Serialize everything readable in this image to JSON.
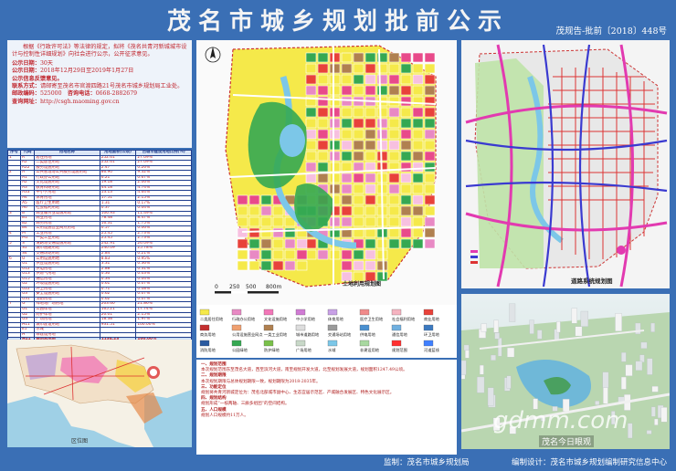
{
  "header": {
    "title": "茂名市城乡规划批前公示",
    "doc_no": "茂规告-批前〔2018〕448号"
  },
  "notice": {
    "body": "根据《行政许可法》等法律的规定，拟将《茂名共青河新城城市设计与控制性详细规划》向社会进行公示，公开征求意见。",
    "period_label": "公示日期：",
    "period_value": "30天",
    "dates_label": "公示日期：",
    "dates_value": "2018年12月29日至2019年1月27日",
    "feedback_label": "公示信息反馈意见。",
    "contact_label": "联系方式：",
    "contact_value": "请邮寄至茂名市官渡四路21号茂名市城乡规划局工业处。",
    "postcode_label": "邮政编码：",
    "postcode_value": "525000",
    "phone_label": "咨询电话：",
    "phone_value": "0668-2882679",
    "website_label": "查询网址：",
    "website_value": "http://csgh.maoming.gov.cn"
  },
  "table": {
    "headers": [
      "序号",
      "代码",
      "用地名称",
      "用地面积(公顷)",
      "占城市建设用地比例(%)"
    ],
    "rows": [
      [
        "1",
        "R",
        "居住用地",
        "252.61",
        "27.09%"
      ],
      [
        "",
        "R2",
        "二类居住用地",
        "252.61",
        "27.09%"
      ],
      [
        "",
        "R22",
        "服务设施用地",
        "2.47",
        "0.26%"
      ],
      [
        "2",
        "A",
        "公共管理与公共服务设施用地",
        "86.90",
        "9.32%"
      ],
      [
        "",
        "A1",
        "行政办公用地",
        "6.21",
        "0.67%"
      ],
      [
        "",
        "A2",
        "文化设施用地",
        "19.18",
        "2.06%"
      ],
      [
        "",
        "A3",
        "教育科研用地",
        "44.18",
        "4.74%"
      ],
      [
        "",
        "A33",
        "中小学用地",
        "53.13",
        "4.64%"
      ],
      [
        "",
        "A4",
        "体育用地",
        "17.51",
        "2.15%"
      ],
      [
        "",
        "A5",
        "医疗卫生用地",
        "1.31",
        "0.17%"
      ],
      [
        "",
        "A6",
        "社会福利用地",
        "0.37",
        "0.04%"
      ],
      [
        "3",
        "B",
        "商业服务业设施用地",
        "106.93",
        "11.49%"
      ],
      [
        "",
        "B1",
        "商业用地",
        "78.48",
        "8.47%"
      ],
      [
        "",
        "B2",
        "商务用地",
        "16.31",
        "1.75%"
      ],
      [
        "",
        "B4",
        "公用设施营业网点用地",
        "0.57",
        "0.06%"
      ],
      [
        "4",
        "M",
        "工业用地",
        "25.45",
        "2.73%"
      ],
      [
        "",
        "M1",
        "一类工业用地",
        "25.45",
        "2.73%"
      ],
      [
        "5",
        "S",
        "道路与交通设施用地",
        "242.91",
        "26.09%"
      ],
      [
        "",
        "S1",
        "城市道路用地",
        "240.09",
        "25.78%"
      ],
      [
        "",
        "S4",
        "交通场站用地",
        "2.84",
        "0.21%"
      ],
      [
        "6",
        "U",
        "公用设施用地",
        "8.83",
        "0.95%"
      ],
      [
        "",
        "U1",
        "供应设施用地",
        "3.31",
        "0.36%"
      ],
      [
        "",
        "U12",
        "供电用地",
        "2.88",
        "0.31%"
      ],
      [
        "",
        "U13",
        "供燃气用地",
        "0.30",
        "0.03%"
      ],
      [
        "",
        "U15",
        "通信用地",
        "0.34",
        "0.04%"
      ],
      [
        "",
        "U2",
        "环境设施用地",
        "0.61",
        "0.07%"
      ],
      [
        "",
        "U22",
        "环卫用地",
        "0.71",
        "0.08%"
      ],
      [
        "",
        "U3",
        "安全设施用地",
        "0.62",
        "0.07%"
      ],
      [
        "",
        "U31",
        "消防用地",
        "0.62",
        "0.07%"
      ],
      [
        "7",
        "G",
        "绿地与广场用地",
        "203.60",
        "21.86%"
      ],
      [
        "",
        "G1",
        "公园绿地",
        "165.21",
        "17.74%"
      ],
      [
        "",
        "G2",
        "防护绿地",
        "20.01",
        "2.15%"
      ],
      [
        "",
        "G3",
        "广场用地",
        "18.38",
        "1.97%"
      ],
      [
        "",
        "H11",
        "城市建设用地",
        "931.51",
        "100.00%"
      ],
      [
        "",
        "E1",
        "水域",
        "",
        ""
      ],
      [
        "",
        "H",
        "非建设用地",
        "",
        ""
      ]
    ],
    "total": [
      "",
      "H11",
      "规划总用地",
      "1134.23",
      "100.00%"
    ]
  },
  "region_caption": "区位图",
  "landuse_caption": "土地利用规划图",
  "scale_labels": [
    "0",
    "250",
    "500",
    "800m"
  ],
  "road_caption": "道路系统规划图",
  "text": {
    "s1_title": "一、规划范围",
    "s1_body": "本次规划范围东至茂名大道，西至滨河大道，南至规划开发大道，北至规划发展大道，规划面积1247.49公顷。",
    "s2_title": "二、规划期限",
    "s2_body": "本次规划期限与总体规划期限一致，规划期限为2018-2035年。",
    "s3_title": "三、功能定位",
    "s3_body": "规划将共青河新城定位为：茂名北部城市副中心、生态宜居示范区、产城融合发展区、特色文化展示区。",
    "s4_title": "四、规划结构",
    "s4_body": "规划形成“一核两轴、三廊多组团”的空间结构。",
    "s5_title": "五、人口规模",
    "s5_body": "规划人口规模约11万人。"
  },
  "footer": {
    "supervise": "监制：茂名市城乡规划局",
    "design": "编制设计：茂名市城乡规划编制研究信息中心"
  },
  "watermark": {
    "site": "gdmm.com",
    "wechat": "茂名今日眼观"
  },
  "colors": {
    "residential": "#f5e94a",
    "commercial": "#e8423a",
    "green": "#35a852",
    "water": "#7cc7e8",
    "public": "#e889c4",
    "industry": "#b08050",
    "road": "#ffffff"
  },
  "legend": [
    {
      "name": "二类居住用地",
      "color": "#f5e94a"
    },
    {
      "name": "行政办公用地",
      "color": "#e889c4"
    },
    {
      "name": "文化设施用地",
      "color": "#f277b8"
    },
    {
      "name": "中小学用地",
      "color": "#d07bd4"
    },
    {
      "name": "体育用地",
      "color": "#c8a0e6"
    },
    {
      "name": "医疗卫生用地",
      "color": "#f08a8a"
    },
    {
      "name": "社会福利用地",
      "color": "#f5b3c0"
    },
    {
      "name": "商业用地",
      "color": "#e8423a"
    },
    {
      "name": "商务用地",
      "color": "#c42e2e"
    },
    {
      "name": "公用设施营业网点",
      "color": "#f0a070"
    },
    {
      "name": "一类工业用地",
      "color": "#b08050"
    },
    {
      "name": "城市道路用地",
      "color": "#dddddd"
    },
    {
      "name": "交通场站用地",
      "color": "#9a9a9a"
    },
    {
      "name": "供电用地",
      "color": "#4a90d0"
    },
    {
      "name": "通信用地",
      "color": "#70b0e0"
    },
    {
      "name": "环卫用地",
      "color": "#3c7ac0"
    },
    {
      "name": "消防用地",
      "color": "#2a5aa0"
    },
    {
      "name": "公园绿地",
      "color": "#35a852"
    },
    {
      "name": "防护绿地",
      "color": "#7ac04a"
    },
    {
      "name": "广场用地",
      "color": "#c8d8c8"
    },
    {
      "name": "水域",
      "color": "#7cc7e8"
    },
    {
      "name": "非建设用地",
      "color": "#a8d8a0"
    },
    {
      "name": "规划范围",
      "color": "#ff3030"
    },
    {
      "name": "河道蓝线",
      "color": "#4080ff"
    }
  ]
}
